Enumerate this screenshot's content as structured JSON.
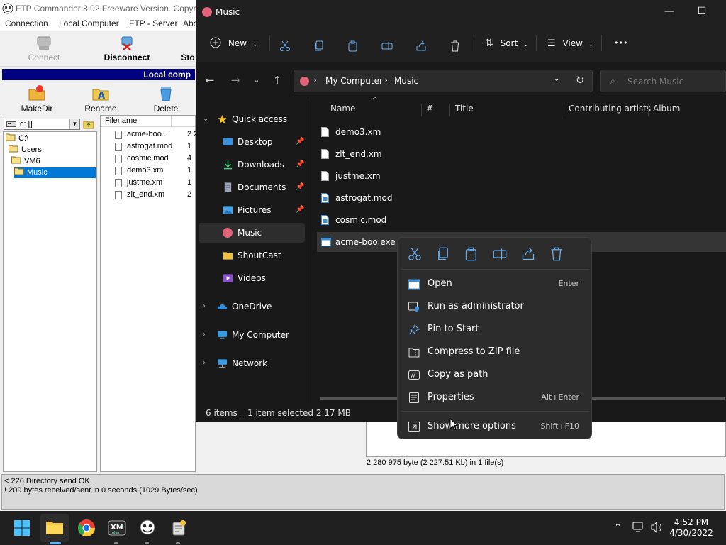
{
  "ftp": {
    "title": "FTP Commander 8.02  Freeware Version.  Copyri",
    "menu": [
      "Connection",
      "Local Computer",
      "FTP - Server",
      "Abo"
    ],
    "toolbar": {
      "connect": "Connect",
      "disconnect": "Disconnect",
      "stop": "Sto"
    },
    "local_panel_title": "Local comp",
    "local_toolbar": {
      "makedir": "MakeDir",
      "rename": "Rename",
      "delete": "Delete"
    },
    "drive": "c: []",
    "tree": [
      "C:\\",
      "Users",
      "VM6",
      "Music"
    ],
    "file_header": "Filename",
    "files": [
      {
        "name": "acme-boo....",
        "size": "2 2"
      },
      {
        "name": "astrogat.mod",
        "size": "1"
      },
      {
        "name": "cosmic.mod",
        "size": "4"
      },
      {
        "name": "demo3.xm",
        "size": "1"
      },
      {
        "name": "justme.xm",
        "size": "1"
      },
      {
        "name": "zlt_end.xm",
        "size": "2"
      }
    ],
    "remote_status": "2 280 975 byte (2 227.51 Kb) in 1 file(s)",
    "log": [
      "< 226 Directory send OK.",
      "! 209 bytes received/sent in 0 seconds (1029 Bytes/sec)"
    ]
  },
  "explorer": {
    "title": "Music",
    "cmd": {
      "new": "New",
      "sort": "Sort",
      "view": "View",
      "more": "•••"
    },
    "breadcrumb": [
      "My Computer",
      "Music"
    ],
    "search_placeholder": "Search Music",
    "nav": {
      "quick_access": "Quick access",
      "desktop": "Desktop",
      "downloads": "Downloads",
      "documents": "Documents",
      "pictures": "Pictures",
      "music": "Music",
      "shoutcast": "ShoutCast",
      "videos": "Videos",
      "onedrive": "OneDrive",
      "mycomputer": "My Computer",
      "network": "Network"
    },
    "columns": {
      "name": "Name",
      "num": "#",
      "title": "Title",
      "artists": "Contributing artists",
      "album": "Album"
    },
    "files": [
      "demo3.xm",
      "zlt_end.xm",
      "justme.xm",
      "astrogat.mod",
      "cosmic.mod",
      "acme-boo.exe"
    ],
    "status": {
      "items": "6 items",
      "selected": "1 item selected  2.17 MB"
    }
  },
  "context_menu": {
    "items": [
      {
        "label": "Open",
        "accel": "Enter"
      },
      {
        "label": "Run as administrator",
        "accel": ""
      },
      {
        "label": "Pin to Start",
        "accel": ""
      },
      {
        "label": "Compress to ZIP file",
        "accel": ""
      },
      {
        "label": "Copy as path",
        "accel": ""
      },
      {
        "label": "Properties",
        "accel": "Alt+Enter"
      }
    ],
    "more": {
      "label": "Show more options",
      "accel": "Shift+F10"
    }
  },
  "taskbar": {
    "time": "4:52 PM",
    "date": "4/30/2022"
  },
  "colors": {
    "accent": "#0078d7",
    "explorer_bg": "#191919",
    "menu_bg": "#2c2c2c",
    "ftp_header": "#000080",
    "music_icon": "#e0637a"
  }
}
